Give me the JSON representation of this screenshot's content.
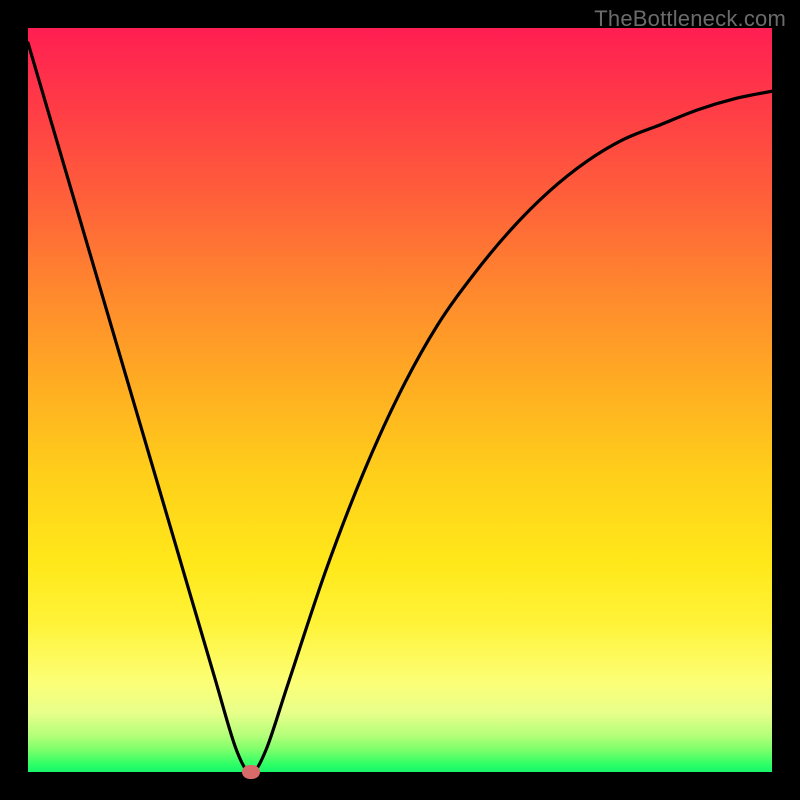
{
  "attribution": "TheBottleneck.com",
  "colors": {
    "frame": "#000000",
    "gradient_top": "#ff1e52",
    "gradient_mid": "#ffcf1a",
    "gradient_bottom": "#18f46a",
    "curve": "#000000",
    "marker": "#d86a6a"
  },
  "chart_data": {
    "type": "line",
    "title": "",
    "xlabel": "",
    "ylabel": "",
    "xlim": [
      0,
      100
    ],
    "ylim": [
      0,
      100
    ],
    "grid": false,
    "legend": false,
    "series": [
      {
        "name": "curve",
        "x": [
          0,
          5,
          10,
          15,
          20,
          25,
          28,
          30,
          32,
          35,
          40,
          45,
          50,
          55,
          60,
          65,
          70,
          75,
          80,
          85,
          90,
          95,
          100
        ],
        "y": [
          98,
          81,
          64,
          47,
          30,
          13,
          3,
          0,
          3,
          12,
          27,
          40,
          51,
          60,
          67,
          73,
          78,
          82,
          85,
          87,
          89,
          90.5,
          91.5
        ]
      }
    ],
    "marker": {
      "x": 30,
      "y": 0
    },
    "annotations": []
  }
}
